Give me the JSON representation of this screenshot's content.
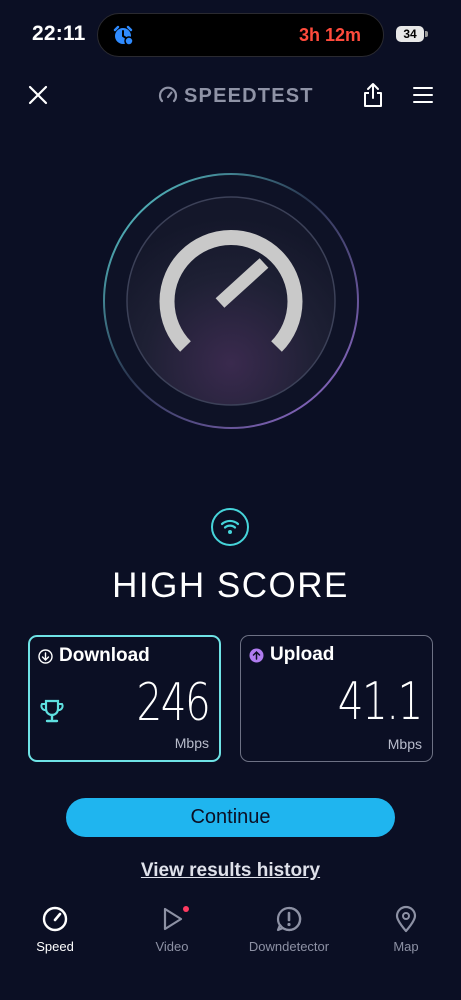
{
  "status_bar": {
    "time": "22:11",
    "timer": "3h 12m",
    "battery": "34"
  },
  "app_bar": {
    "logo_text": "SPEEDTEST"
  },
  "score": {
    "title": "HIGH SCORE"
  },
  "results": {
    "download": {
      "label": "Download",
      "value": "246",
      "unit": "Mbps"
    },
    "upload": {
      "label": "Upload",
      "value": "41.1",
      "unit": "Mbps"
    }
  },
  "actions": {
    "continue_label": "Continue",
    "history_label": "View results history"
  },
  "bottom_nav": {
    "items": [
      {
        "label": "Speed",
        "icon": "speed-gauge-icon",
        "active": true
      },
      {
        "label": "Video",
        "icon": "play-icon",
        "active": false
      },
      {
        "label": "Downdetector",
        "icon": "alert-icon",
        "active": false
      },
      {
        "label": "Map",
        "icon": "map-pin-icon",
        "active": false
      }
    ]
  },
  "colors": {
    "background": "#0b0f24",
    "accent_cyan": "#6fe3e6",
    "button_blue": "#1fb5ef",
    "timer_red": "#ff4b3c",
    "upload_purple": "#b07cf0"
  }
}
